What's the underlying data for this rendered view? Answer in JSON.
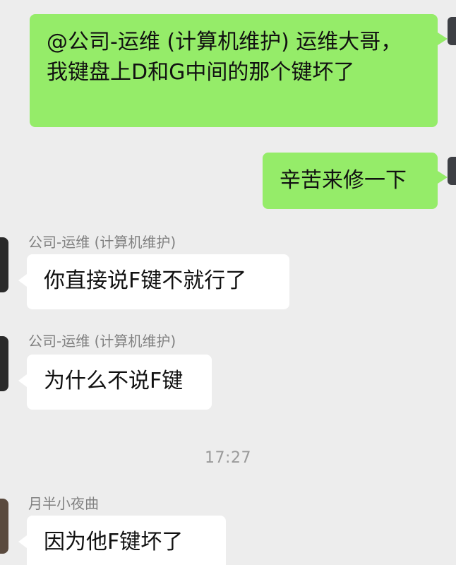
{
  "messages": {
    "m1": {
      "text": "@公司-运维 (计算机维护) 运维大哥，我键盘上D和G中间的那个键坏了"
    },
    "m2": {
      "text": "辛苦来修一下"
    },
    "m3": {
      "sender": "公司-运维 (计算机维护)",
      "text": "你直接说F键不就行了"
    },
    "m4": {
      "sender": "公司-运维 (计算机维护)",
      "text": "为什么不说F键"
    },
    "m5": {
      "sender": "月半小夜曲",
      "text": "因为他F键坏了"
    }
  },
  "timestamp": "17:27",
  "colors": {
    "background": "#ededed",
    "outgoing_bubble": "#95ec69",
    "incoming_bubble": "#ffffff",
    "meta_text": "#808080"
  }
}
